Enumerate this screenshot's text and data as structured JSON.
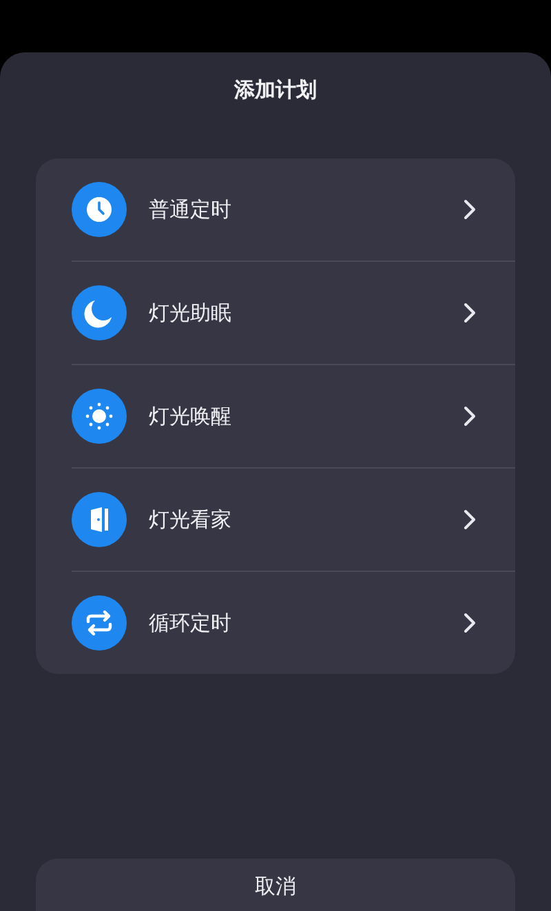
{
  "title": "添加计划",
  "items": [
    {
      "label": "普通定时"
    },
    {
      "label": "灯光助眠"
    },
    {
      "label": "灯光唤醒"
    },
    {
      "label": "灯光看家"
    },
    {
      "label": "循环定时"
    }
  ],
  "cancel_button": "取消"
}
